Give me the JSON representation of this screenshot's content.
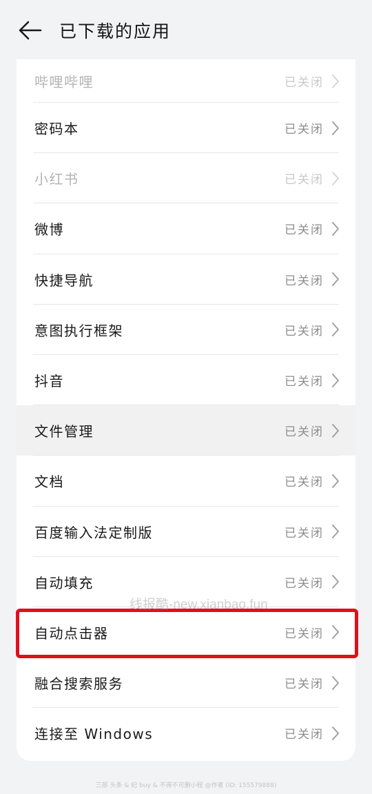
{
  "header": {
    "title": "已下载的应用"
  },
  "status_text": "已关闭",
  "apps": [
    {
      "label": "哔哩哔哩",
      "status": "已关闭",
      "state": "disabled"
    },
    {
      "label": "密码本",
      "status": "已关闭",
      "state": "normal"
    },
    {
      "label": "小红书",
      "status": "已关闭",
      "state": "disabled"
    },
    {
      "label": "微博",
      "status": "已关闭",
      "state": "normal"
    },
    {
      "label": "快捷导航",
      "status": "已关闭",
      "state": "normal"
    },
    {
      "label": "意图执行框架",
      "status": "已关闭",
      "state": "normal"
    },
    {
      "label": "抖音",
      "status": "已关闭",
      "state": "normal"
    },
    {
      "label": "文件管理",
      "status": "已关闭",
      "state": "pressed"
    },
    {
      "label": "文档",
      "status": "已关闭",
      "state": "normal"
    },
    {
      "label": "百度输入法定制版",
      "status": "已关闭",
      "state": "normal"
    },
    {
      "label": "自动填充",
      "status": "已关闭",
      "state": "normal"
    },
    {
      "label": "自动点击器",
      "status": "已关闭",
      "state": "normal"
    },
    {
      "label": "融合搜索服务",
      "status": "已关闭",
      "state": "normal"
    },
    {
      "label": "连接至 Windows",
      "status": "已关闭",
      "state": "normal"
    }
  ],
  "watermark": "线报酷-new.xianbao.fun",
  "footer_watermark": "三部 头条 & 纪 buy & 不得不可删小程 @作者 (ID: 155579888)",
  "colors": {
    "highlight_border": "#e0101a",
    "background": "#f1f3f5",
    "card": "#ffffff"
  },
  "icons": {
    "back": "arrow-left-icon",
    "row_chevron": "chevron-right-icon"
  }
}
